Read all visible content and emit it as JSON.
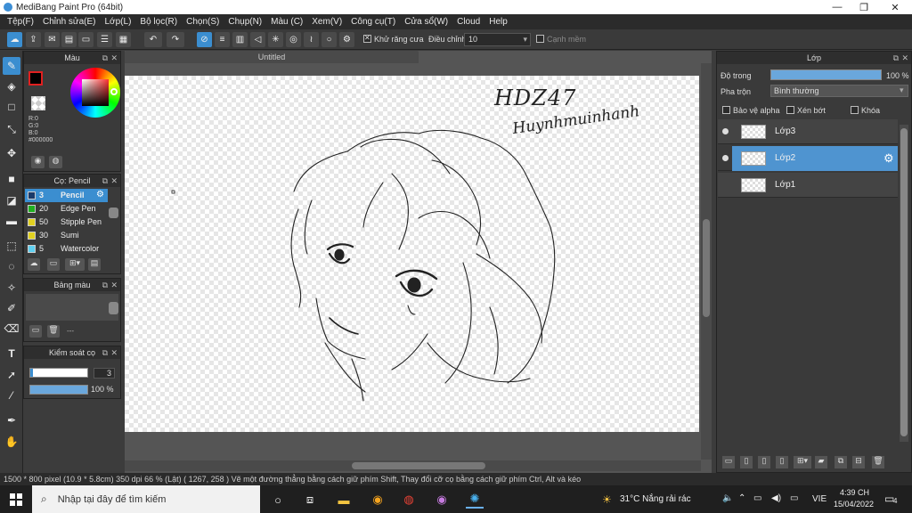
{
  "window": {
    "title": "MediBang Paint Pro (64bit)",
    "minimize": "—",
    "maximize": "❐",
    "close": "✕"
  },
  "menu": [
    "Tệp(F)",
    "Chỉnh sửa(E)",
    "Lớp(L)",
    "Bộ lọc(R)",
    "Chọn(S)",
    "Chụp(N)",
    "Màu (C)",
    "Xem(V)",
    "Công cụ(T)",
    "Cửa sổ(W)",
    "Cloud",
    "Help"
  ],
  "toolbar": {
    "antialias_label": "Khử răng cưa",
    "smooth_label": "Điều chỉnh",
    "smooth_value": "10",
    "edge_label": "Cạnh mềm"
  },
  "color_panel": {
    "title": "Màu",
    "r": "R:0",
    "g": "G:0",
    "b": "B:0",
    "hex": "#000000"
  },
  "brush_panel": {
    "title": "Cọ: Pencil",
    "items": [
      {
        "size": "3",
        "name": "Pencil",
        "color": "#1a3a6a",
        "selected": true
      },
      {
        "size": "20",
        "name": "Edge Pen",
        "color": "#20b020"
      },
      {
        "size": "50",
        "name": "Stipple Pen",
        "color": "#e0d020"
      },
      {
        "size": "30",
        "name": "Sumi",
        "color": "#e0d020"
      },
      {
        "size": "5",
        "name": "Watercolor",
        "color": "#60d0f0"
      }
    ]
  },
  "palette_panel": {
    "title": "Bảng màu",
    "dash": "---"
  },
  "brush_control": {
    "title": "Kiểm soát cọ",
    "size_value": "3",
    "opacity_value": "100 %"
  },
  "canvas": {
    "tab_title": "Untitled",
    "signature_line1": "HDZ47",
    "signature_line2": "Huynhmuinhanh"
  },
  "layers_panel": {
    "title": "Lớp",
    "opacity_label": "Độ trong",
    "opacity_value": "100 %",
    "blend_label": "Pha trộn",
    "blend_value": "Bình thường",
    "protect_alpha": "Bảo vệ alpha",
    "clipping": "Xén bớt",
    "lock": "Khóa",
    "layers": [
      {
        "name": "Lớp3",
        "visible": true,
        "selected": false
      },
      {
        "name": "Lớp2",
        "visible": true,
        "selected": true
      },
      {
        "name": "Lớp1",
        "visible": false,
        "selected": false
      }
    ]
  },
  "status": {
    "text": "1500 * 800 pixel   (10.9 * 5.8cm)   350 dpi   66 % (Lật)   ( 1267, 258 )   Vẽ một đường thẳng bằng cách giữ phím Shift, Thay đổi cỡ cọ bằng cách giữ phím Ctrl, Alt và kéo"
  },
  "taskbar": {
    "search_placeholder": "Nhập tại đây để tìm kiếm",
    "weather": "31°C  Nắng rải rác",
    "lang": "VIE",
    "time": "4:39 CH",
    "date": "15/04/2022",
    "notif_count": "4"
  },
  "colors": {
    "accent": "#3b8ed0",
    "panel": "#3a3a3a",
    "dark": "#2b2b2b"
  }
}
